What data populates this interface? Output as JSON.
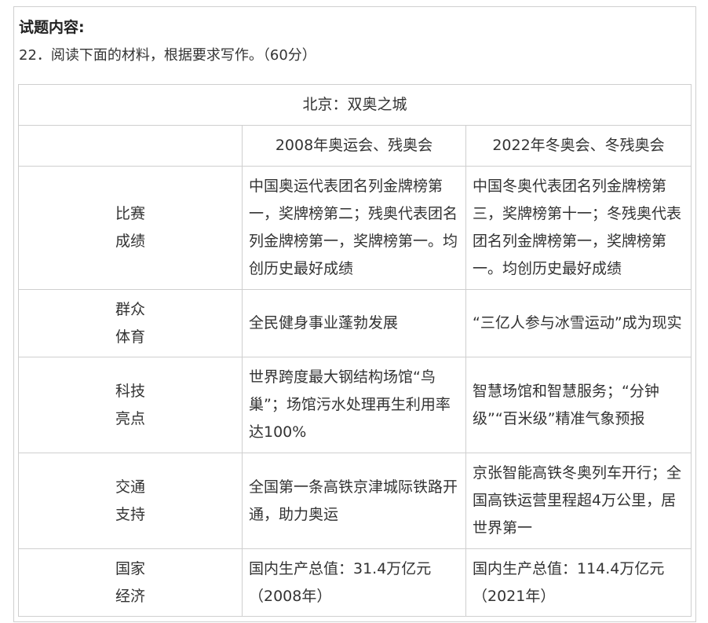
{
  "heading": "试题内容:",
  "question": "22．阅读下面的材料，根据要求写作。（60分）",
  "table": {
    "title": "北京：双奥之城",
    "columns": [
      "",
      "2008年奥运会、残奥会",
      "2022年冬奥会、冬残奥会"
    ],
    "rows": [
      {
        "label_lines": [
          "比赛",
          "成绩"
        ],
        "c2008": "中国奥运代表团名列金牌榜第一，奖牌榜第二；残奥代表团名列金牌榜第一，奖牌榜第一。均创历史最好成绩",
        "c2022": "中国冬奥代表团名列金牌榜第三，奖牌榜第十一；冬残奥代表团名列金牌榜第一，奖牌榜第一。均创历史最好成绩"
      },
      {
        "label_lines": [
          "群众",
          "体育"
        ],
        "c2008": "全民健身事业蓬勃发展",
        "c2022": "“三亿人参与冰雪运动”成为现实"
      },
      {
        "label_lines": [
          "科技",
          "亮点"
        ],
        "c2008": "世界跨度最大钢结构场馆“鸟巢”；场馆污水处理再生利用率达100%",
        "c2022": "智慧场馆和智慧服务；“分钟级”“百米级”精准气象预报"
      },
      {
        "label_lines": [
          "交通",
          "支持"
        ],
        "c2008": "全国第一条高铁京津城际铁路开通，助力奥运",
        "c2022": "京张智能高铁冬奥列车开行；全国高铁运营里程超4万公里，居世界第一"
      },
      {
        "label_lines": [
          "国家",
          "经济"
        ],
        "c2008": "国内生产总值：31.4万亿元（2008年）",
        "c2022": "国内生产总值：114.4万亿元（2021年）"
      }
    ]
  }
}
